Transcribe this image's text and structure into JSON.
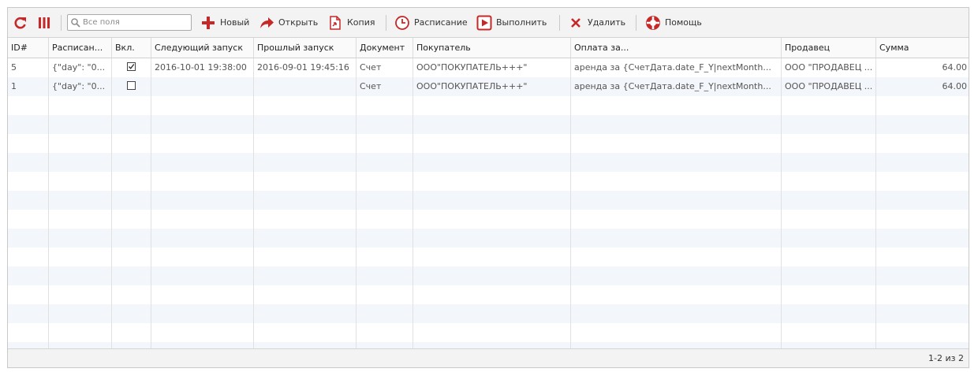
{
  "toolbar": {
    "search_placeholder": "Все поля",
    "new_label": "Новый",
    "open_label": "Открыть",
    "copy_label": "Копия",
    "schedule_label": "Расписание",
    "run_label": "Выполнить",
    "delete_label": "Удалить",
    "help_label": "Помощь"
  },
  "columns": [
    "ID#",
    "Расписан...",
    "Вкл.",
    "Следующий запуск",
    "Прошлый запуск",
    "Документ",
    "Покупатель",
    "Оплата за...",
    "Продавец",
    "Сумма"
  ],
  "rows": [
    {
      "id": "5",
      "schedule": "{\"day\": \"0...",
      "enabled": true,
      "next_run": "2016-10-01 19:38:00",
      "last_run": "2016-09-01 19:45:16",
      "document": "Счет",
      "buyer": "ООО\"ПОКУПАТЕЛЬ+++\"",
      "payment_for": "аренда за {СчетДата.date_F_Y|nextMonth...",
      "seller": "ООО \"ПРОДАВЕЦ ...",
      "amount": "64.00"
    },
    {
      "id": "1",
      "schedule": "{\"day\": \"0...",
      "enabled": false,
      "next_run": "",
      "last_run": "",
      "document": "Счет",
      "buyer": "ООО\"ПОКУПАТЕЛЬ+++\"",
      "payment_for": "аренда за {СчетДата.date_F_Y|nextMonth...",
      "seller": "ООО \"ПРОДАВЕЦ ...",
      "amount": "64.00"
    }
  ],
  "footer": {
    "pager": "1-2 из 2"
  },
  "colors": {
    "accent": "#c62828",
    "row_alt": "#f3f6fa"
  },
  "icons": [
    "refresh-icon",
    "columns-icon",
    "search-icon",
    "plus-icon",
    "open-arrow-icon",
    "copy-icon",
    "clock-icon",
    "play-icon",
    "delete-x-icon",
    "lifebuoy-icon"
  ]
}
